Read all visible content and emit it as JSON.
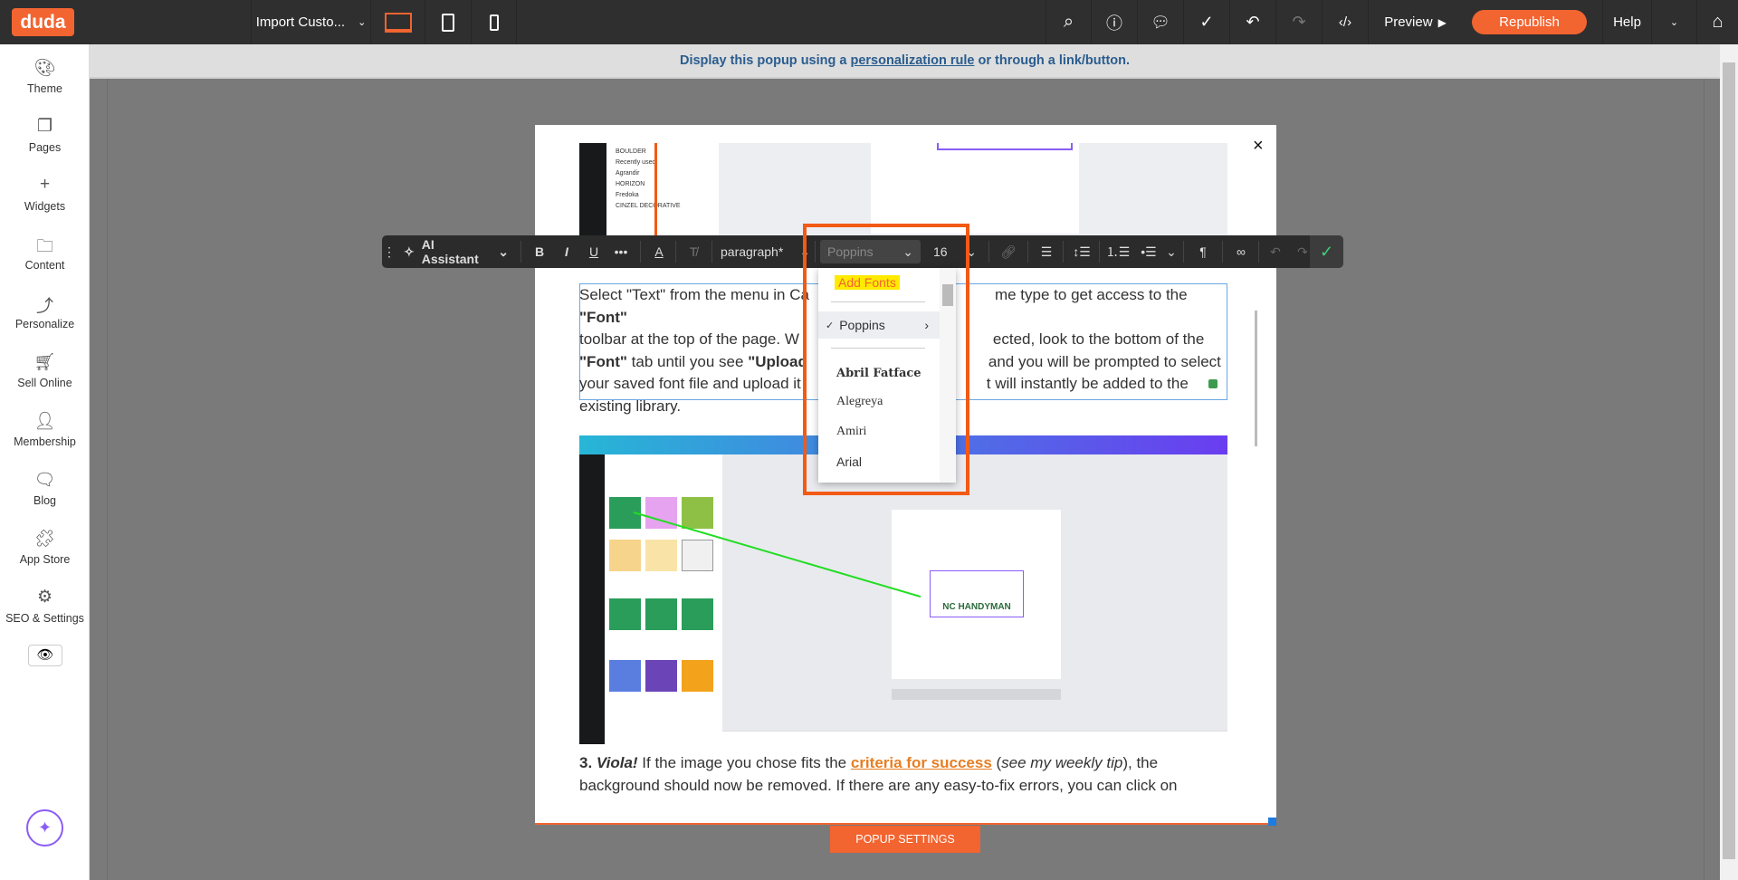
{
  "topbar": {
    "logo": "duda",
    "page_select": "Import Custo...",
    "preview": "Preview",
    "republish": "Republish",
    "help": "Help"
  },
  "sidebar": {
    "items": [
      {
        "label": "Theme"
      },
      {
        "label": "Pages"
      },
      {
        "label": "Widgets"
      },
      {
        "label": "Content"
      },
      {
        "label": "Personalize"
      },
      {
        "label": "Sell Online"
      },
      {
        "label": "Membership"
      },
      {
        "label": "Blog"
      },
      {
        "label": "App Store"
      },
      {
        "label": "SEO & Settings"
      }
    ]
  },
  "banner": {
    "pre": "Display this popup using a ",
    "link": "personalization rule",
    "post": " or through a link/button."
  },
  "toolbar": {
    "ai": "AI Assistant",
    "style": "paragraph*",
    "font": "Poppins",
    "size": "16"
  },
  "dropdown": {
    "add_fonts": "Add Fonts",
    "items": [
      "Poppins",
      "Abril Fatface",
      "Alegreya",
      "Amiri",
      "Arial"
    ]
  },
  "content": {
    "p1_a": "Select \"Text\" from the menu in Ca",
    "p1_b": "me type to get access to the ",
    "p1_font": "\"Font\"",
    "p1_line2a": "toolbar at the top of the page. W",
    "p1_line2b": "ected, look to the bottom of the",
    "p1_line3a": "\"Font\"",
    "p1_line3b": " tab until you see ",
    "p1_line3c": "\"Upload",
    "p1_line3d": "and you will be prompted to select",
    "p1_line4a": "your saved font file and upload it",
    "p1_line4b": "t will instantly be added to the",
    "p1_line5": "existing library.",
    "p3_num": "3. ",
    "p3_viola": "Viola!",
    "p3_a": " If the image you chose fits the ",
    "p3_link": "criteria for success",
    "p3_b": " (",
    "p3_italic": "see my weekly tip",
    "p3_c": "), the",
    "p3_line2": "background should now be removed. If there are any easy-to-fix errors, you can click on",
    "img2_label": "NC HANDYMAN"
  },
  "popup_settings": "POPUP SETTINGS",
  "colors": {
    "brand": "#f26430",
    "highlight": "#ffea00"
  }
}
